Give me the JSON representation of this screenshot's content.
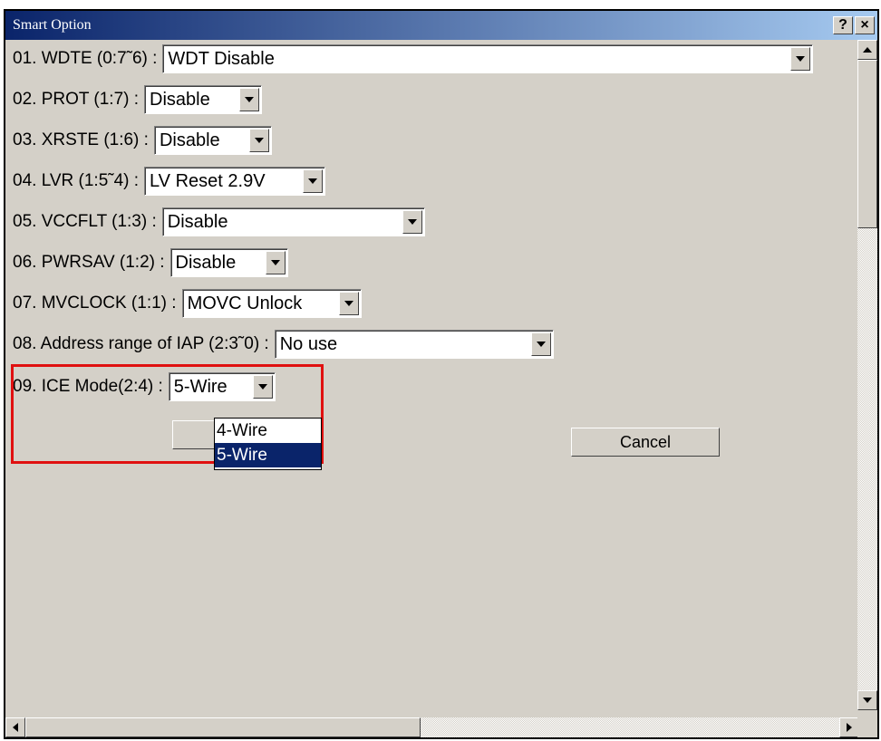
{
  "window": {
    "title": "Smart Option",
    "help_glyph": "?",
    "close_glyph": "×"
  },
  "options": [
    {
      "label": "01. WDTE (0:7˜6) :",
      "value": "WDT Disable"
    },
    {
      "label": "02. PROT (1:7) :",
      "value": "Disable"
    },
    {
      "label": "03. XRSTE (1:6) :",
      "value": "Disable"
    },
    {
      "label": "04. LVR (1:5˜4) :",
      "value": "LV Reset 2.9V"
    },
    {
      "label": "05. VCCFLT (1:3) :",
      "value": "Disable"
    },
    {
      "label": "06. PWRSAV (1:2) :",
      "value": "Disable"
    },
    {
      "label": "07. MVCLOCK (1:1) :",
      "value": "MOVC Unlock"
    },
    {
      "label": "08. Address range of IAP (2:3˜0) :",
      "value": "No use"
    },
    {
      "label": "09. ICE Mode(2:4) :",
      "value": "5-Wire"
    }
  ],
  "ice_dropdown": {
    "options": [
      "4-Wire",
      "5-Wire"
    ],
    "selected": "5-Wire"
  },
  "buttons": {
    "ok_label": "",
    "cancel_label": "Cancel"
  },
  "colors": {
    "highlight_border": "#e01010",
    "selection": "#0a246a",
    "titlebar": "#0a246a"
  }
}
